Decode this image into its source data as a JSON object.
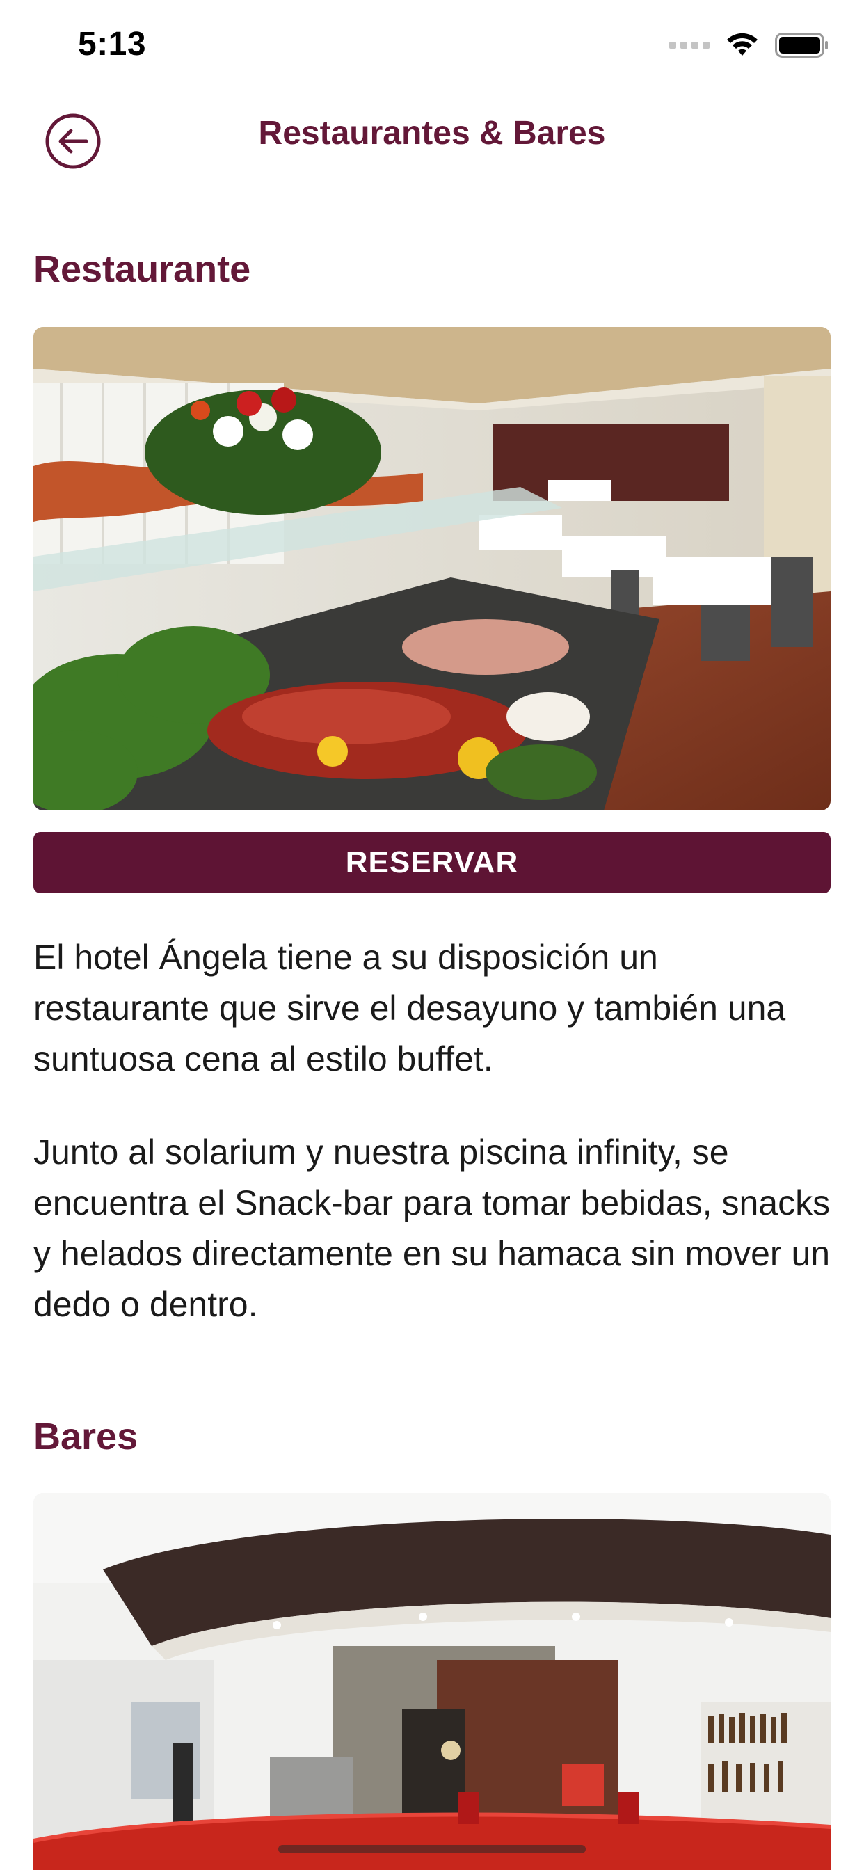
{
  "status_bar": {
    "time": "5:13",
    "icons": [
      "signal-icon",
      "wifi-icon",
      "battery-icon"
    ]
  },
  "nav": {
    "back_icon": "back-arrow-circle-icon",
    "title": "Restaurantes & Bares"
  },
  "restaurant": {
    "heading": "Restaurante",
    "reserve_label": "RESERVAR",
    "paragraphs": [
      "El hotel Ángela tiene a su disposición un restaurante que sirve el desayuno y también una suntuosa cena al estilo buffet.",
      "Junto al solarium y nuestra piscina infinity, se encuentra el Snack-bar para tomar bebidas, snacks y helados directamente en su hamaca sin mover un dedo o dentro."
    ]
  },
  "bars": {
    "heading": "Bares"
  },
  "colors": {
    "brand": "#631838",
    "button": "#5e1434",
    "text": "#1a1a1a"
  }
}
